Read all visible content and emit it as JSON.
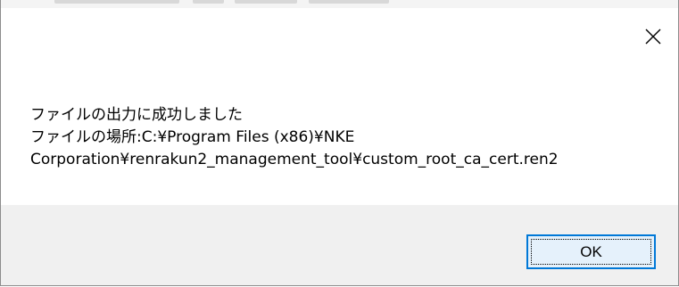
{
  "dialog": {
    "message_lines": [
      "ファイルの出力に成功しました",
      "ファイルの場所:C:¥Program Files (x86)¥NKE",
      "Corporation¥renrakun2_management_tool¥custom_root_ca_cert.ren2"
    ],
    "ok_label": "OK",
    "close_icon": "close-icon"
  },
  "colors": {
    "accent": "#0078d7",
    "button_fill": "#e5f1fb",
    "footer": "#f0f0f0"
  }
}
